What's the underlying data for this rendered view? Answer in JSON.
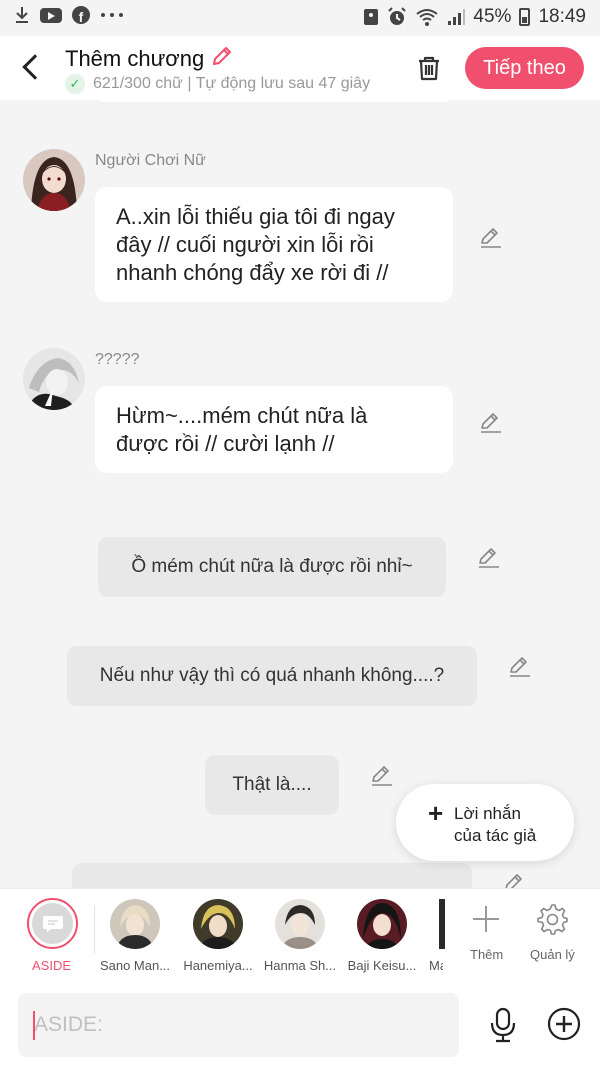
{
  "status_bar": {
    "battery": "45%",
    "time": "18:49",
    "icons": [
      "download-icon",
      "youtube-icon",
      "facebook-icon",
      "more-dots-icon",
      "image-icon",
      "alarm-icon",
      "wifi-icon",
      "signal-icon",
      "battery-icon"
    ]
  },
  "header": {
    "title": "Thêm chương",
    "subtitle": "621/300 chữ | Tự động lưu sau 47 giây",
    "next_label": "Tiếp theo",
    "accent": "#f0506e"
  },
  "messages": [
    {
      "sender": "Người Chơi Nữ",
      "text_lines": [
        "A..xin lỗi thiếu gia tôi đi ngay",
        "đây // cuối người xin lỗi rồi",
        "nhanh chóng đẩy xe rời đi //"
      ]
    },
    {
      "sender": "?????",
      "text_lines": [
        "Hừm~....mém chút nữa là",
        "được rồi // cười lạnh //"
      ]
    }
  ],
  "narrations": [
    "Ồ mém chút nữa là được rồi nhỉ~",
    "Nếu như vậy thì có quá nhanh không....?",
    "Thật là...."
  ],
  "floating_button": {
    "line1": "Lời nhắn",
    "line2": "của tác giả"
  },
  "char_bar": {
    "aside_label": "ASIDE",
    "characters": [
      "Sano Man...",
      "Hanemiya...",
      "Hanma Sh...",
      "Baji Keisu...",
      "Ma"
    ],
    "add_label": "Thêm",
    "manage_label": "Quản lý"
  },
  "input": {
    "placeholder": "ASIDE:"
  }
}
